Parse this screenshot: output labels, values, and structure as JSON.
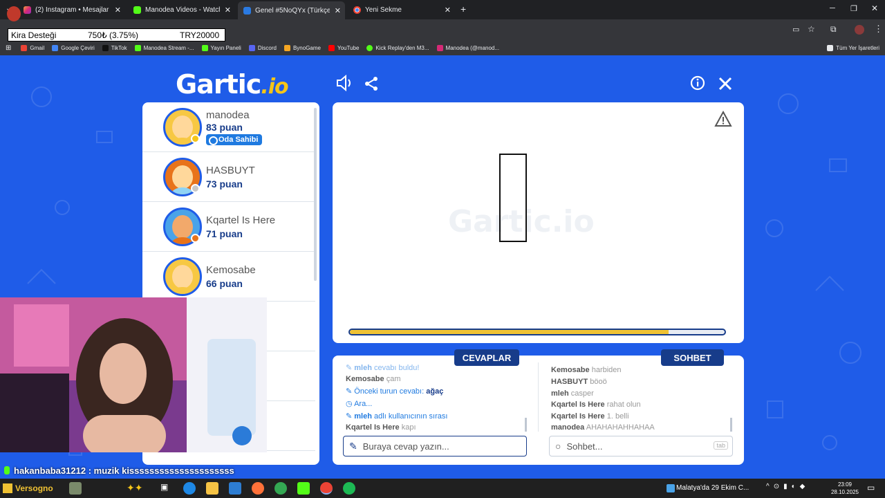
{
  "browser": {
    "tabs": [
      {
        "title": "(2) Instagram • Mesajlar",
        "active": false
      },
      {
        "title": "Manodea Videos - Watch On-D",
        "active": false
      },
      {
        "title": "Genel #5NoQYx (Türkçe) - Gart",
        "active": true
      },
      {
        "title": "Yeni Sekme",
        "active": false
      }
    ],
    "bookmarks": [
      "Gmail",
      "Google Çeviri",
      "TikTok",
      "Manodea Stream -...",
      "Yayın Paneli",
      "Discord",
      "BynoGame",
      "YouTube",
      "Kick Replay'den M3...",
      "Manodea (@manod..."
    ],
    "all_bookmarks": "Tüm Yer İşaretleri"
  },
  "rent_banner": {
    "label": "Kira Desteği",
    "amount": "750₺ (3.75%)",
    "goal": "TRY20000"
  },
  "game": {
    "logo": "Gartic",
    "logo_suffix": ".io",
    "players": [
      {
        "name": "manodea",
        "score": "83 puan",
        "badge": "Oda Sahibi",
        "status_color": "#f5c518"
      },
      {
        "name": "HASBUYT",
        "score": "73 puan",
        "status_color": "#c8c8c8"
      },
      {
        "name": "Kqartel Is Here",
        "score": "71 puan",
        "status_color": "#e8731a"
      },
      {
        "name": "Kemosabe",
        "score": "66 puan",
        "status_color": null
      }
    ],
    "timer_progress": 0.85,
    "watermark": "Gartic.io",
    "answers": {
      "header": "CEVAPLAR",
      "lines": [
        {
          "user": "mleh",
          "text": "cevabı buldu!",
          "system": true
        },
        {
          "user": "Kemosabe",
          "text": "çam",
          "system": false
        },
        {
          "user": "",
          "text": "Önceki turun cevabı:",
          "answer": "ağaç",
          "system": true
        },
        {
          "user": "",
          "text": "Ara...",
          "system": true
        },
        {
          "user": "mleh",
          "text": "adlı kullanıcının sırası",
          "system": true
        },
        {
          "user": "Kqartel Is Here",
          "text": "kapı",
          "system": false
        }
      ],
      "placeholder": "Buraya cevap yazın..."
    },
    "chat": {
      "header": "SOHBET",
      "lines": [
        {
          "user": "Kemosabe",
          "text": "harbiden"
        },
        {
          "user": "HASBUYT",
          "text": "böoö"
        },
        {
          "user": "mleh",
          "text": "casper"
        },
        {
          "user": "Kqartel Is Here",
          "text": "rahat olun"
        },
        {
          "user": "Kqartel Is Here",
          "text": "1. belli"
        },
        {
          "user": "manodea",
          "text": "AHAHAHAHHAHAA"
        }
      ],
      "placeholder": "Sohbet...",
      "tab_hint": "tab"
    }
  },
  "stream_chat": {
    "user": "hakanbaba31212",
    "message": "muzik kisssssssssssssssssssss"
  },
  "taskbar": {
    "start_label": "Versogno",
    "weather": "Malatya'da 29 Ekim C...",
    "time": "23:09",
    "date": "28.10.2025"
  }
}
